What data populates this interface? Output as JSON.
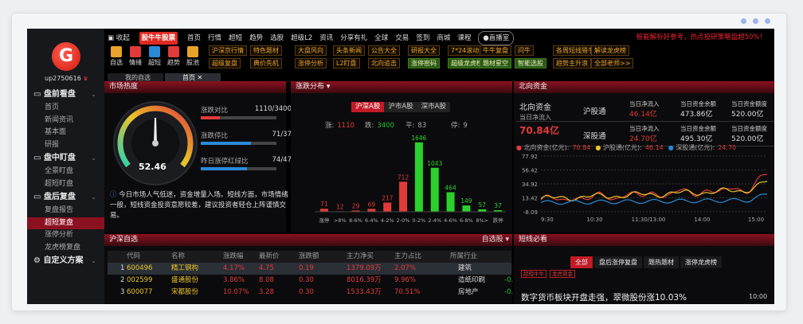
{
  "window": {
    "collapse_label": "收起",
    "brand": "股牛牛股票"
  },
  "topnav": {
    "items": [
      "首页",
      "行情",
      "超短",
      "趋势",
      "选股",
      "超级L2",
      "资讯",
      "分享有礼",
      "全球",
      "交易",
      "签到",
      "商城",
      "课程"
    ],
    "live": "直播室",
    "promo": "智能解析好参考，热点投研策略盘超50%！"
  },
  "user": {
    "name": "up2750616"
  },
  "sidebar": {
    "sections": [
      {
        "title": "盘前看盘",
        "items": [
          "首页",
          "新闻资讯",
          "基本面",
          "研报"
        ]
      },
      {
        "title": "盘中盯盘",
        "items": [
          "全景盯盘",
          "超短盯盘"
        ]
      },
      {
        "title": "盘后复盘",
        "items": [
          "复盘报告",
          "超短复盘",
          "涨停分析",
          "龙虎榜复盘"
        ]
      },
      {
        "title": "自定义方案",
        "items": []
      }
    ],
    "active": "超短复盘"
  },
  "toolbar": {
    "tools": [
      {
        "label": "自选",
        "icon": "folder-icon",
        "color": "#e9a329"
      },
      {
        "label": "情绪",
        "icon": "heart-icon",
        "color": "#e23a3a"
      },
      {
        "label": "超短",
        "icon": "folder-icon",
        "color": "#2a8ad8"
      },
      {
        "label": "趋势",
        "icon": "target-icon",
        "color": "#e23a3a"
      },
      {
        "label": "股池",
        "icon": "chart-icon",
        "color": "#e9a329"
      }
    ]
  },
  "chips": {
    "row1": [
      "沪深京行情",
      "特色题材",
      "大盘风向",
      "头条新闻",
      "公告大全",
      "研报大全",
      "7*24滚动",
      "牛牛复盘",
      "问牛",
      "各周短线猎手",
      "解读龙虎榜"
    ],
    "row2": [
      "超级复盘",
      "典价先机",
      "涨停分析",
      "L2盯盘",
      "北向追击",
      "涨停密码",
      "超级龙虎榜",
      "题材星空",
      "智能选股",
      "趋势主升浪",
      "全部老师>>"
    ]
  },
  "tabs": {
    "items": [
      "我的自选",
      "首页"
    ]
  },
  "heat": {
    "title": "市场热度",
    "score": "52.46",
    "stats": [
      {
        "label": "涨跌对比",
        "value": "1110/3400",
        "pct": 0.25,
        "color": "#e23a3a"
      },
      {
        "label": "涨跌停比",
        "value": "71/37",
        "pct": 0.66,
        "color": "#2a8ad8"
      },
      {
        "label": "昨日涨停红绿比",
        "value": "74/47",
        "pct": 0.61,
        "color": "#2a8ad8"
      }
    ],
    "tip": "今日市场人气低迷，资金增量入场。短线方面，市场情绪一般，短线资金投资意愿较差，建议投资者轻仓上阵谨慎交易。"
  },
  "dist": {
    "title": "涨跌分布",
    "tabs": [
      "沪深A股",
      "沪市A股",
      "深市A股"
    ],
    "stats": [
      {
        "label": "涨:",
        "value": "1110",
        "color": "#e23a3a"
      },
      {
        "label": "跌:",
        "value": "3400",
        "color": "#2bc02b"
      },
      {
        "label": "平:",
        "value": "83",
        "color": "#aaa"
      },
      {
        "label": "停:",
        "value": "9",
        "color": "#aaa"
      }
    ]
  },
  "chart_data": [
    {
      "type": "bar",
      "categories": [
        "涨停",
        ">8%",
        "8-6%",
        "6-4%",
        "4-2%",
        "2-0%",
        "0-2%",
        "2-4%",
        "4-6%",
        "6-8%",
        "8%>",
        "跌停"
      ],
      "values": [
        71,
        12,
        29,
        69,
        217,
        712,
        1646,
        1043,
        464,
        149,
        57,
        37
      ],
      "colors": [
        "#e23a3a",
        "#e23a3a",
        "#e23a3a",
        "#e23a3a",
        "#e23a3a",
        "#e23a3a",
        "#2bd12b",
        "#2bd12b",
        "#2bd12b",
        "#2bd12b",
        "#2bd12b",
        "#2bd12b"
      ]
    },
    {
      "type": "line",
      "title": "北向资金",
      "x": [
        "9:30",
        "10:30",
        "11:30/13:00",
        "14:00",
        "15:00"
      ],
      "ylim": [
        -8.09,
        77.92
      ],
      "yticks": [
        77.92,
        56.42,
        34.92,
        13.42,
        -8.09
      ],
      "legend": [
        {
          "name": "北向资金(亿元):",
          "value": "70.84",
          "color": "#e23a3a"
        },
        {
          "name": "沪股通(亿元):",
          "value": "46.14",
          "color": "#e9c329"
        },
        {
          "name": "深股通(亿元):",
          "value": "24.70",
          "color": "#2a8ad8"
        }
      ]
    }
  ],
  "north": {
    "title": "北向资金",
    "label": "北向资金",
    "sub": "当日净流入",
    "value": "70.84亿",
    "rows": [
      {
        "name": "沪股通",
        "cols": [
          [
            "当日净流入",
            "46.14亿"
          ],
          [
            "当日资金余额",
            "473.86亿"
          ],
          [
            "当日资金额度",
            "520.00亿"
          ]
        ]
      },
      {
        "name": "深股通",
        "cols": [
          [
            "当日净流入",
            "24.70亿"
          ],
          [
            "当日资金余额",
            "495.30亿"
          ],
          [
            "当日资金额度",
            "520.00亿"
          ]
        ]
      }
    ]
  },
  "watch": {
    "title": "沪深自选",
    "filter": "自选股",
    "headers": [
      "代码",
      "名称",
      "涨跌幅",
      "最新价",
      "涨跌额",
      "主力净买",
      "主力占比",
      "所属行业"
    ],
    "rows": [
      [
        "1",
        "600496",
        "精工钢构",
        "4.17%",
        "4.75",
        "0.19",
        "1379.09万",
        "2.07%",
        "建筑"
      ],
      [
        "2",
        "002599",
        "盛通股份",
        "3.86%",
        "8.08",
        "0.30",
        "8016.39万",
        "9.96%",
        "造纸印刷"
      ],
      [
        "3",
        "600077",
        "宋都股份",
        "10.07%",
        "3.28",
        "0.30",
        "1533.43万",
        "70.51%",
        "房地产"
      ]
    ]
  },
  "must": {
    "title": "短线必看",
    "tabs": [
      "全部",
      "盘后涨停复盘",
      "题热题材",
      "涨停龙虎榜"
    ],
    "tags": [
      "超短牛牛",
      "龙虎资金"
    ],
    "headline": "数字货币板块开盘走强，翠微股份涨10.03%",
    "time": "10:00"
  }
}
